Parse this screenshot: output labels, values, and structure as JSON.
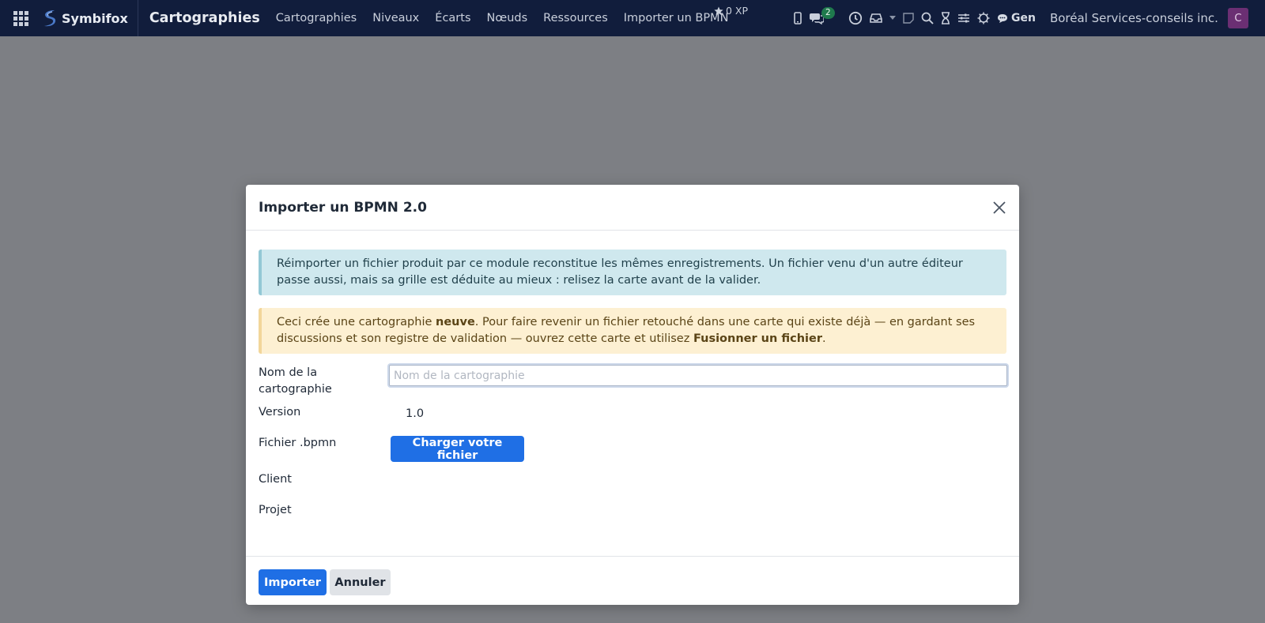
{
  "navbar": {
    "brand": "Symbifox",
    "app_title": "Cartographies",
    "menu": [
      "Cartographies",
      "Niveaux",
      "Écarts",
      "Nœuds",
      "Ressources",
      "Importer un BPMN"
    ],
    "xp": "0 XP",
    "messages_count": "2",
    "gen_label": "Gen",
    "company": "Boréal Services-conseils inc.",
    "avatar_initial": "C"
  },
  "modal": {
    "title": "Importer un BPMN 2.0",
    "info_alert": "Réimporter un fichier produit par ce module reconstitue les mêmes enregistrements. Un fichier venu d'un autre éditeur passe aussi, mais sa grille est déduite au mieux : relisez la carte avant de la valider.",
    "warning_alert": {
      "part1": "Ceci crée une cartographie ",
      "bold1": "neuve",
      "part2": ". Pour faire revenir un fichier retouché dans une carte qui existe déjà — en gardant ses discussions et son registre de validation — ouvrez cette carte et utilisez ",
      "bold2": "Fusionner un fichier",
      "part3": "."
    },
    "fields": {
      "name_label": "Nom de la cartographie",
      "name_placeholder": "Nom de la cartographie",
      "version_label": "Version",
      "version_value": "1.0",
      "file_label": "Fichier .bpmn",
      "upload_button": "Charger votre fichier",
      "client_label": "Client",
      "project_label": "Projet"
    },
    "footer": {
      "import_button": "Importer",
      "cancel_button": "Annuler"
    }
  },
  "colors": {
    "navbar_bg": "#111d3c",
    "primary": "#1f6fe5",
    "backdrop": "#7d7f84"
  }
}
